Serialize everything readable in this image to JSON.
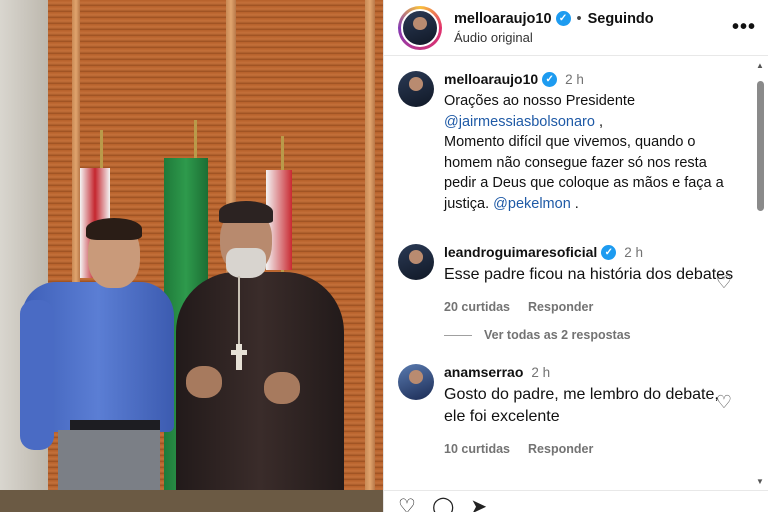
{
  "post": {
    "username": "melloaraujo10",
    "follow_status": "Seguindo",
    "audio_label": "Áudio original",
    "more_icon": "more-horizontal-icon"
  },
  "caption": {
    "username": "melloaraujo10",
    "time": "2 h",
    "text_1": "Orações ao nosso Presidente",
    "mention_1": "@jairmessiasbolsonaro",
    "text_2": " ,",
    "text_3": "Momento difícil que vivemos, quando o homem não consegue fazer só nos resta pedir a Deus que coloque as mãos e faça a justiça. ",
    "mention_2": "@pekelmon",
    "text_4": " ."
  },
  "comments": [
    {
      "username": "leandroguimaresoficial",
      "verified": true,
      "time": "2 h",
      "text": "Esse padre ficou na história dos debates",
      "likes": "20 curtidas",
      "reply_label": "Responder",
      "view_replies": "Ver todas as 2 respostas"
    },
    {
      "username": "anamserrao",
      "verified": false,
      "time": "2 h",
      "text": "Gosto do padre, me lembro do debate, ele foi excelente",
      "likes": "10 curtidas",
      "reply_label": "Responder"
    }
  ],
  "colors": {
    "verified_badge": "#1d9bf0",
    "mention": "#1f5aa6",
    "muted_text": "#737373"
  }
}
